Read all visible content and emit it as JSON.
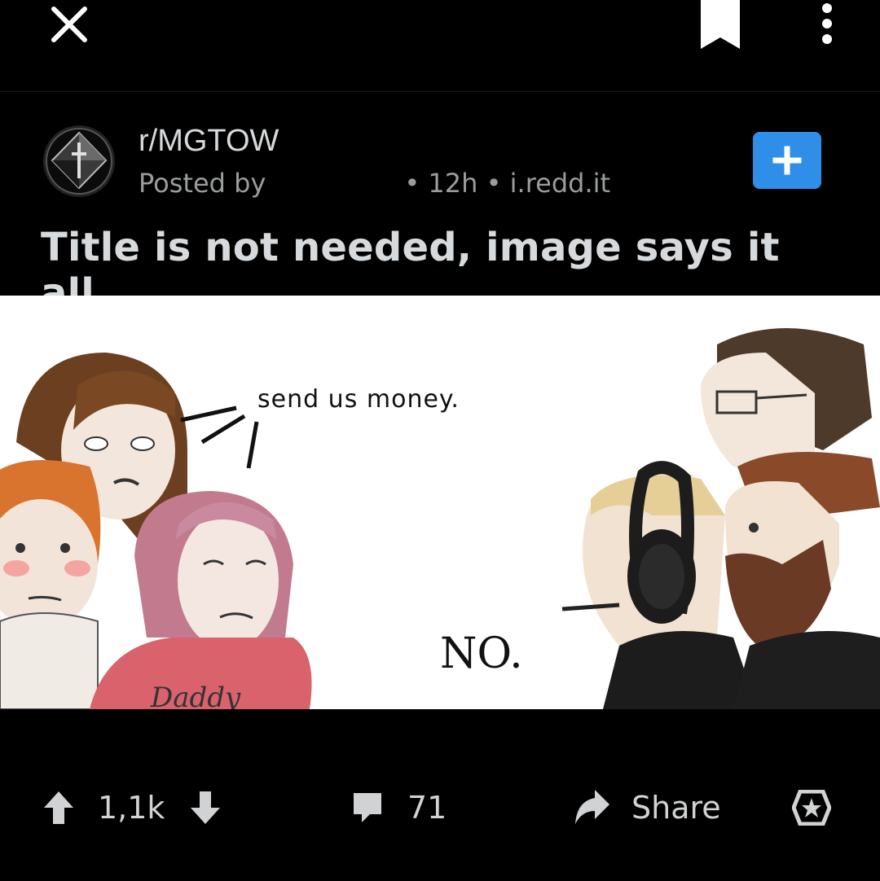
{
  "topbar": {
    "close_icon": "close-icon",
    "bookmark_icon": "bookmark-icon",
    "more_icon": "more-vertical-icon"
  },
  "post": {
    "subreddit": "r/MGTOW",
    "posted_by": "Posted by",
    "age": "• 12h",
    "domain": "• i.redd.it",
    "title": "Title is not needed, image says it all...",
    "join_icon": "plus-icon"
  },
  "meme": {
    "left_text": "send us money.",
    "right_text": "NO.",
    "shirt_text": "Daddy"
  },
  "actions": {
    "score": "1,1k",
    "comments": "71",
    "share": "Share"
  },
  "colors": {
    "background": "#000000",
    "accent": "#2f8fe8",
    "text": "#d7dadc",
    "muted": "#9a9c9e"
  }
}
